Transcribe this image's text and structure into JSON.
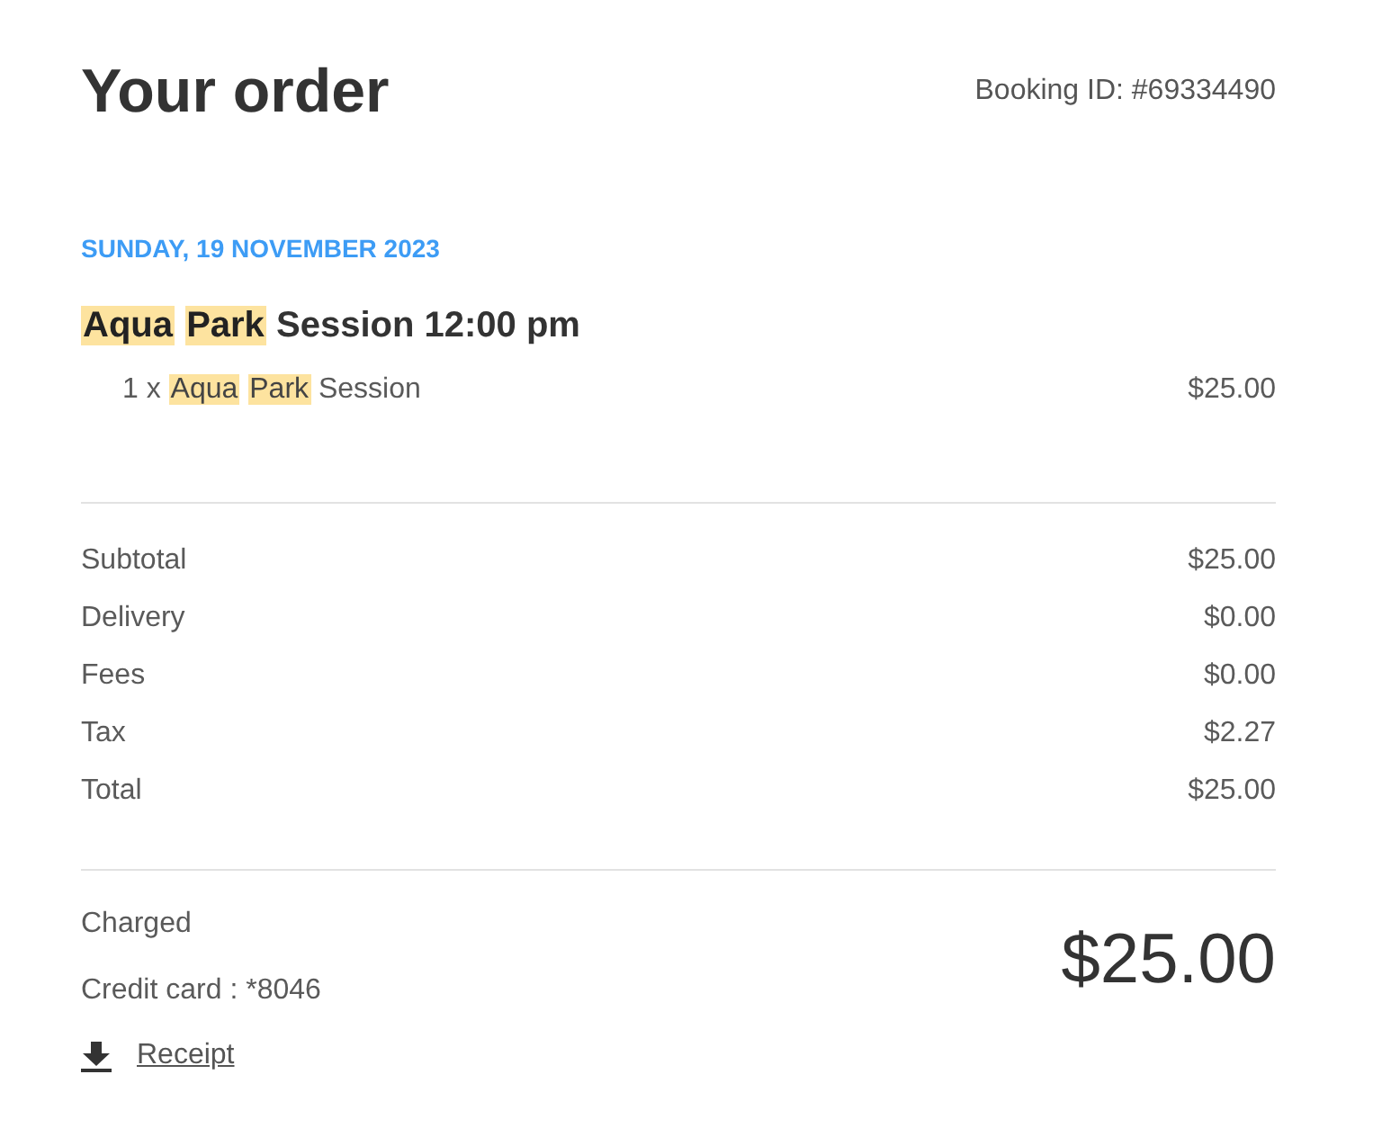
{
  "header": {
    "title": "Your order",
    "booking_id": "Booking ID: #69334490"
  },
  "session": {
    "date": "SUNDAY, 19 NOVEMBER 2023",
    "title": [
      {
        "text": "Aqua",
        "highlighted": true
      },
      {
        "text": "Park",
        "highlighted": true
      },
      {
        "text": "Session 12:00 pm",
        "highlighted": false
      }
    ],
    "items": [
      {
        "description": [
          {
            "text": "1 x",
            "highlighted": false
          },
          {
            "text": "Aqua",
            "highlighted": true
          },
          {
            "text": "Park",
            "highlighted": true
          },
          {
            "text": "Session",
            "highlighted": false
          }
        ],
        "price": "$25.00"
      }
    ]
  },
  "summary": [
    {
      "label": "Subtotal",
      "value": "$25.00"
    },
    {
      "label": "Delivery",
      "value": "$0.00"
    },
    {
      "label": "Fees",
      "value": "$0.00"
    },
    {
      "label": "Tax",
      "value": "$2.27"
    },
    {
      "label": "Total",
      "value": "$25.00"
    }
  ],
  "payment": {
    "label": "Charged",
    "method": "Credit card : *8046",
    "amount": "$25.00",
    "receipt_link": "Receipt"
  }
}
